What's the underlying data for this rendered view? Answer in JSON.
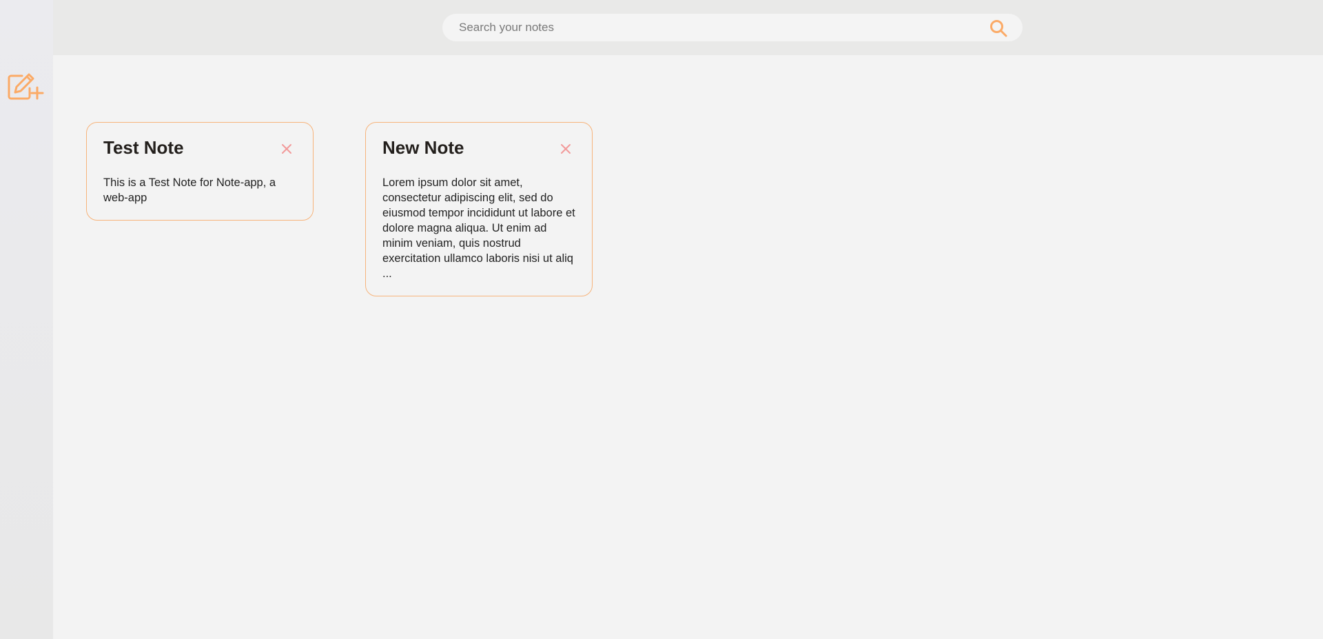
{
  "sidebar": {
    "add_note_icon": "edit-plus-icon"
  },
  "search": {
    "placeholder": "Search your notes",
    "value": "",
    "icon": "search-icon"
  },
  "notes": [
    {
      "title": "Test Note",
      "body": "This is a Test Note for Note-app, a web-app",
      "close_icon": "close-icon"
    },
    {
      "title": "New Note",
      "body": "Lorem ipsum dolor sit amet, consectetur adipiscing elit, sed do eiusmod tempor incididunt ut labore et dolore magna aliqua. Ut enim ad minim veniam, quis nostrud exercitation ullamco laboris nisi ut aliq ...",
      "close_icon": "close-icon"
    }
  ],
  "colors": {
    "accent": "#fbaa66",
    "card_border": "#f7b37a",
    "close": "#f29a9a",
    "sidebar_bg": "#e8e8e8",
    "topbar_bg": "#e9e9e8",
    "page_bg": "#f3f3f3"
  }
}
